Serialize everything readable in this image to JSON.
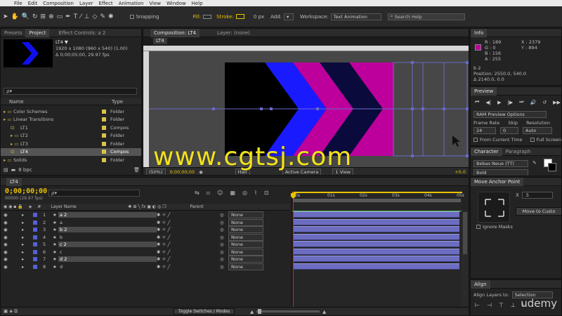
{
  "menu": [
    "File",
    "Edit",
    "Composition",
    "Layer",
    "Effect",
    "Animation",
    "View",
    "Window",
    "Help"
  ],
  "toolbar": {
    "snapping": "Snapping",
    "fill": "Fill:",
    "stroke": "Stroke:",
    "stroke_px": "0 px",
    "add": "Add:",
    "workspace_label": "Workspace:",
    "workspace_value": "Text Animation",
    "search_help": "Search Help"
  },
  "project": {
    "tabs": [
      "Presets",
      "Project",
      "Effect Controls: a 2"
    ],
    "comp_name": "LT4 ▼",
    "comp_res": "1920 x 1080 (960 x 540) (1.00)",
    "comp_dur": "Δ 0;00;05;00, 29.97 fps",
    "col_name": "Name",
    "col_type": "Type",
    "items": [
      {
        "name": "Color Schemes",
        "type": "Folder",
        "indent": 0,
        "kind": "folder",
        "color": "#d8c44a"
      },
      {
        "name": "Linear Transitions",
        "type": "Folder",
        "indent": 0,
        "kind": "folder",
        "color": "#d8c44a"
      },
      {
        "name": "LT1",
        "type": "Compos",
        "indent": 1,
        "kind": "comp",
        "color": "#d8c44a"
      },
      {
        "name": "LT2",
        "type": "Folder",
        "indent": 1,
        "kind": "folder",
        "color": "#d8c44a"
      },
      {
        "name": "LT3",
        "type": "Folder",
        "indent": 1,
        "kind": "folder",
        "color": "#d8c44a"
      },
      {
        "name": "LT4",
        "type": "Compos",
        "indent": 1,
        "kind": "comp",
        "color": "#d8c44a",
        "selected": true
      },
      {
        "name": "Solids",
        "type": "Folder",
        "indent": 0,
        "kind": "folder",
        "color": "#d8c44a"
      }
    ],
    "bpc": "8 bpc"
  },
  "composition": {
    "tab": "Composition: LT4",
    "layer_tab": "Layer: (none)",
    "comp_chip": "LT4",
    "bottom": {
      "zoom": "(50%)",
      "time": "0;00;00;00",
      "res": "Half",
      "view": "Active Camera",
      "views": "1 View",
      "offset": "+0.0"
    }
  },
  "watermark": "www.cgtsj.com",
  "udemy": "udemy",
  "info": {
    "title": "Info",
    "r": "R : 189",
    "g": "G : 0",
    "b": "B : 156",
    "a": "A : 255",
    "x": "X : 2379",
    "y": "Y : 894",
    "swatch": "#bd009c",
    "layer": "b 2",
    "position": "Position: 2550.0, 540.0",
    "delta": "Δ 2140.0, 0.0"
  },
  "preview": {
    "title": "Preview",
    "ram": "RAM Preview Options",
    "frame_rate_label": "Frame Rate",
    "skip_label": "Skip",
    "resolution_label": "Resolution",
    "frame_rate": "24",
    "skip": "0",
    "resolution": "Auto",
    "from_current": "From Current Time",
    "full_screen": "Full Screen"
  },
  "character": {
    "tabs": [
      "Character",
      "Paragraph"
    ],
    "font": "Bebas Neue (TT)",
    "style": "Bold"
  },
  "anchor": {
    "title": "Move Anchor Point",
    "x_label": "X",
    "x_value": ".5",
    "move_btn": "Move to Custo",
    "ignore_masks": "Ignore Masks"
  },
  "align": {
    "title": "Align",
    "layers_to": "Align Layers to:",
    "selection": "Selection"
  },
  "timeline": {
    "tab": "LT4",
    "timecode": "0;00;00;00",
    "fps": "00000 (29.97 fps)",
    "search_placeholder": "ρ▾",
    "col_num": "#",
    "col_layer": "Layer Name",
    "col_parent": "Parent",
    "ruler": [
      "0s",
      "01s",
      "02s",
      "03s",
      "04s",
      "05s"
    ],
    "toggle": "Toggle Switches / Modes",
    "layers": [
      {
        "num": "1",
        "name": "a 2",
        "parent": "None",
        "highlight": true
      },
      {
        "num": "2",
        "name": "a",
        "parent": "None",
        "highlight": false
      },
      {
        "num": "3",
        "name": "b 2",
        "parent": "None",
        "highlight": true
      },
      {
        "num": "4",
        "name": "b",
        "parent": "None",
        "highlight": false
      },
      {
        "num": "5",
        "name": "c 2",
        "parent": "None",
        "highlight": true
      },
      {
        "num": "6",
        "name": "c",
        "parent": "None",
        "highlight": false
      },
      {
        "num": "7",
        "name": "d 2",
        "parent": "None",
        "highlight": true
      },
      {
        "num": "8",
        "name": "d",
        "parent": "None",
        "highlight": false
      }
    ]
  },
  "colors": {
    "accent": "#e8c200",
    "magenta": "#bd009c",
    "blue": "#1a1aff",
    "navy": "#0a0a3c",
    "layer_label": "#5560d8"
  }
}
